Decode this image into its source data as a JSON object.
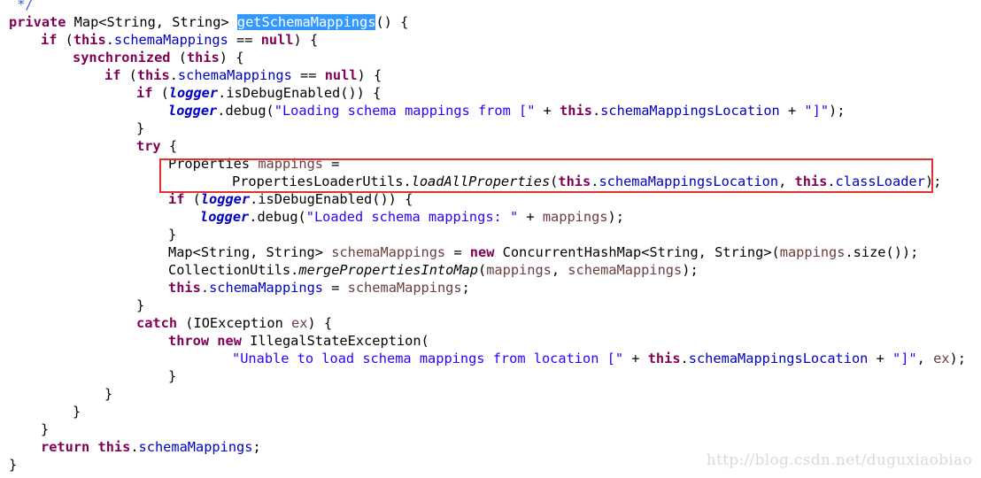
{
  "code": {
    "lines": [
      {
        "indent": 0,
        "tokens": [
          {
            "t": " */",
            "c": "comment"
          }
        ]
      },
      {
        "indent": 0,
        "tokens": [
          {
            "t": "private",
            "c": "kw"
          },
          {
            "t": " Map<String, String> ",
            "c": "plain"
          },
          {
            "t": "getSchemaMappings",
            "c": "sel"
          },
          {
            "t": "() {",
            "c": "plain"
          }
        ]
      },
      {
        "indent": 1,
        "tokens": [
          {
            "t": "if",
            "c": "kw"
          },
          {
            "t": " (",
            "c": "plain"
          },
          {
            "t": "this",
            "c": "kw"
          },
          {
            "t": ".",
            "c": "plain"
          },
          {
            "t": "schemaMappings",
            "c": "field"
          },
          {
            "t": " == ",
            "c": "plain"
          },
          {
            "t": "null",
            "c": "kw"
          },
          {
            "t": ") {",
            "c": "plain"
          }
        ]
      },
      {
        "indent": 2,
        "tokens": [
          {
            "t": "synchronized",
            "c": "kw"
          },
          {
            "t": " (",
            "c": "plain"
          },
          {
            "t": "this",
            "c": "kw"
          },
          {
            "t": ") {",
            "c": "plain"
          }
        ]
      },
      {
        "indent": 3,
        "tokens": [
          {
            "t": "if",
            "c": "kw"
          },
          {
            "t": " (",
            "c": "plain"
          },
          {
            "t": "this",
            "c": "kw"
          },
          {
            "t": ".",
            "c": "plain"
          },
          {
            "t": "schemaMappings",
            "c": "field"
          },
          {
            "t": " == ",
            "c": "plain"
          },
          {
            "t": "null",
            "c": "kw"
          },
          {
            "t": ") {",
            "c": "plain"
          }
        ]
      },
      {
        "indent": 4,
        "tokens": [
          {
            "t": "if",
            "c": "kw"
          },
          {
            "t": " (",
            "c": "plain"
          },
          {
            "t": "logger",
            "c": "static-field"
          },
          {
            "t": ".isDebugEnabled()) {",
            "c": "plain"
          }
        ]
      },
      {
        "indent": 5,
        "tokens": [
          {
            "t": "logger",
            "c": "static-field"
          },
          {
            "t": ".debug(",
            "c": "plain"
          },
          {
            "t": "\"Loading schema mappings from [\"",
            "c": "str"
          },
          {
            "t": " + ",
            "c": "plain"
          },
          {
            "t": "this",
            "c": "kw"
          },
          {
            "t": ".",
            "c": "plain"
          },
          {
            "t": "schemaMappingsLocation",
            "c": "field"
          },
          {
            "t": " + ",
            "c": "plain"
          },
          {
            "t": "\"]\"",
            "c": "str"
          },
          {
            "t": ");",
            "c": "plain"
          }
        ]
      },
      {
        "indent": 4,
        "tokens": [
          {
            "t": "}",
            "c": "plain"
          }
        ]
      },
      {
        "indent": 4,
        "tokens": [
          {
            "t": "try",
            "c": "kw"
          },
          {
            "t": " {",
            "c": "plain"
          }
        ]
      },
      {
        "indent": 5,
        "tokens": [
          {
            "t": "Properties ",
            "c": "plain"
          },
          {
            "t": "mappings",
            "c": "local"
          },
          {
            "t": " =",
            "c": "plain"
          }
        ]
      },
      {
        "indent": 7,
        "tokens": [
          {
            "t": "PropertiesLoaderUtils.",
            "c": "plain"
          },
          {
            "t": "loadAllProperties",
            "c": "static-method"
          },
          {
            "t": "(",
            "c": "plain"
          },
          {
            "t": "this",
            "c": "kw"
          },
          {
            "t": ".",
            "c": "plain"
          },
          {
            "t": "schemaMappingsLocation",
            "c": "field"
          },
          {
            "t": ", ",
            "c": "plain"
          },
          {
            "t": "this",
            "c": "kw"
          },
          {
            "t": ".",
            "c": "plain"
          },
          {
            "t": "classLoader",
            "c": "field"
          },
          {
            "t": ");",
            "c": "plain"
          }
        ]
      },
      {
        "indent": 5,
        "tokens": [
          {
            "t": "if",
            "c": "kw"
          },
          {
            "t": " (",
            "c": "plain"
          },
          {
            "t": "logger",
            "c": "static-field"
          },
          {
            "t": ".isDebugEnabled()) {",
            "c": "plain"
          }
        ]
      },
      {
        "indent": 6,
        "tokens": [
          {
            "t": "logger",
            "c": "static-field"
          },
          {
            "t": ".debug(",
            "c": "plain"
          },
          {
            "t": "\"Loaded schema mappings: \"",
            "c": "str"
          },
          {
            "t": " + ",
            "c": "plain"
          },
          {
            "t": "mappings",
            "c": "local"
          },
          {
            "t": ");",
            "c": "plain"
          }
        ]
      },
      {
        "indent": 5,
        "tokens": [
          {
            "t": "}",
            "c": "plain"
          }
        ]
      },
      {
        "indent": 5,
        "tokens": [
          {
            "t": "Map<String, String> ",
            "c": "plain"
          },
          {
            "t": "schemaMappings",
            "c": "local"
          },
          {
            "t": " = ",
            "c": "plain"
          },
          {
            "t": "new",
            "c": "kw"
          },
          {
            "t": " ConcurrentHashMap<String, String>(",
            "c": "plain"
          },
          {
            "t": "mappings",
            "c": "local"
          },
          {
            "t": ".size());",
            "c": "plain"
          }
        ]
      },
      {
        "indent": 5,
        "tokens": [
          {
            "t": "CollectionUtils.",
            "c": "plain"
          },
          {
            "t": "mergePropertiesIntoMap",
            "c": "static-method"
          },
          {
            "t": "(",
            "c": "plain"
          },
          {
            "t": "mappings",
            "c": "local"
          },
          {
            "t": ", ",
            "c": "plain"
          },
          {
            "t": "schemaMappings",
            "c": "local"
          },
          {
            "t": ");",
            "c": "plain"
          }
        ]
      },
      {
        "indent": 5,
        "tokens": [
          {
            "t": "this",
            "c": "kw"
          },
          {
            "t": ".",
            "c": "plain"
          },
          {
            "t": "schemaMappings",
            "c": "field"
          },
          {
            "t": " = ",
            "c": "plain"
          },
          {
            "t": "schemaMappings",
            "c": "local"
          },
          {
            "t": ";",
            "c": "plain"
          }
        ]
      },
      {
        "indent": 4,
        "tokens": [
          {
            "t": "}",
            "c": "plain"
          }
        ]
      },
      {
        "indent": 4,
        "tokens": [
          {
            "t": "catch",
            "c": "kw"
          },
          {
            "t": " (IOException ",
            "c": "plain"
          },
          {
            "t": "ex",
            "c": "local"
          },
          {
            "t": ") {",
            "c": "plain"
          }
        ]
      },
      {
        "indent": 5,
        "tokens": [
          {
            "t": "throw",
            "c": "kw"
          },
          {
            "t": " ",
            "c": "plain"
          },
          {
            "t": "new",
            "c": "kw"
          },
          {
            "t": " IllegalStateException(",
            "c": "plain"
          }
        ]
      },
      {
        "indent": 7,
        "tokens": [
          {
            "t": "\"Unable to load schema mappings from location [\"",
            "c": "str"
          },
          {
            "t": " + ",
            "c": "plain"
          },
          {
            "t": "this",
            "c": "kw"
          },
          {
            "t": ".",
            "c": "plain"
          },
          {
            "t": "schemaMappingsLocation",
            "c": "field"
          },
          {
            "t": " + ",
            "c": "plain"
          },
          {
            "t": "\"]\"",
            "c": "str"
          },
          {
            "t": ", ",
            "c": "plain"
          },
          {
            "t": "ex",
            "c": "local"
          },
          {
            "t": ");",
            "c": "plain"
          }
        ]
      },
      {
        "indent": 5,
        "tokens": [
          {
            "t": "}",
            "c": "plain"
          }
        ]
      },
      {
        "indent": 3,
        "tokens": [
          {
            "t": "}",
            "c": "plain"
          }
        ]
      },
      {
        "indent": 2,
        "tokens": [
          {
            "t": "}",
            "c": "plain"
          }
        ]
      },
      {
        "indent": 1,
        "tokens": [
          {
            "t": "}",
            "c": "plain"
          }
        ]
      },
      {
        "indent": 1,
        "tokens": [
          {
            "t": "return",
            "c": "kw"
          },
          {
            "t": " ",
            "c": "plain"
          },
          {
            "t": "this",
            "c": "kw"
          },
          {
            "t": ".",
            "c": "plain"
          },
          {
            "t": "schemaMappings",
            "c": "field"
          },
          {
            "t": ";",
            "c": "plain"
          }
        ]
      },
      {
        "indent": 0,
        "tokens": [
          {
            "t": "}",
            "c": "plain"
          }
        ]
      }
    ]
  },
  "watermark": "http://blog.csdn.net/duguxiaobiao",
  "colors": {
    "keyword": "#7f0055",
    "field": "#0000c0",
    "local_variable": "#6a3e3e",
    "string": "#2a00ff",
    "comment": "#3f5fbf",
    "selection": "#3399ff",
    "highlight_box": "#e53030",
    "background": "#ffffff"
  }
}
